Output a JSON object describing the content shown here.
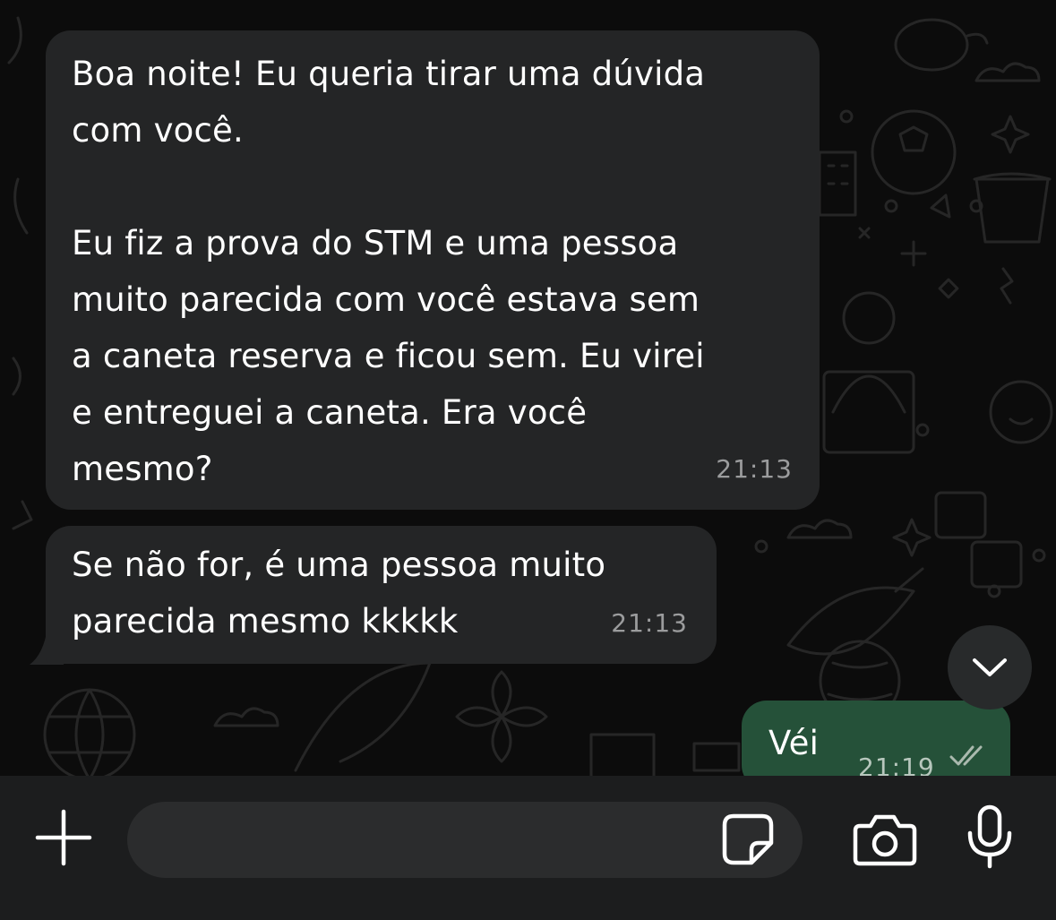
{
  "conversation": {
    "messages": [
      {
        "direction": "incoming",
        "text": "Boa noite! Eu queria tirar uma dúvida\ncom você.\n\nEu fiz a prova do STM e uma pessoa\nmuito parecida com você estava sem\na caneta reserva e ficou sem. Eu virei\ne entreguei a caneta. Era você\nmesmo?",
        "time": "21:13"
      },
      {
        "direction": "incoming",
        "text": "Se não for, é uma pessoa muito\nparecida mesmo kkkkk",
        "time": "21:13"
      },
      {
        "direction": "outgoing",
        "text": "Véi",
        "time": "21:19",
        "status": "read"
      }
    ]
  },
  "icons": {
    "scroll_down": "chevron-down-icon",
    "attach": "plus-icon",
    "sticker": "sticker-icon",
    "camera": "camera-icon",
    "mic": "microphone-icon",
    "read_status": "double-check-icon"
  },
  "composer": {
    "value": "",
    "placeholder": ""
  },
  "colors": {
    "chat_background": "#0c0c0c",
    "incoming_bubble": "#242526",
    "outgoing_bubble": "#255139",
    "composer_bar": "#1c1d1e",
    "composer_field": "#2b2c2d",
    "timestamp": "#9b9c9d"
  }
}
